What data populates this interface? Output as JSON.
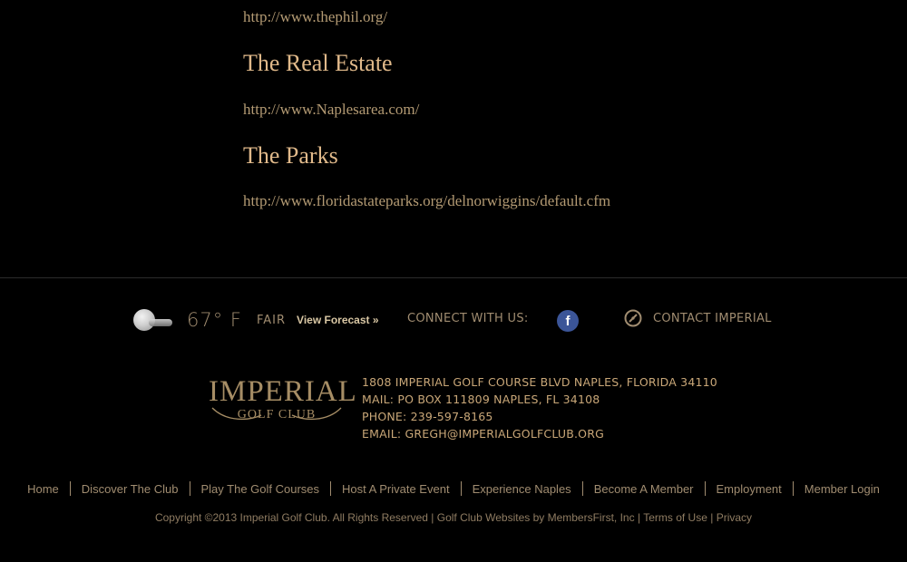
{
  "main": {
    "links": [
      {
        "url": "http://www.thephil.org/"
      },
      {
        "heading": "The Real Estate",
        "url": "http://www.Naplesarea.com/"
      },
      {
        "heading": "The Parks",
        "url": "http://www.floridastateparks.org/delnorwiggins/default.cfm"
      }
    ]
  },
  "weather": {
    "icon": "moon-cloud-icon",
    "temperature": "67° F",
    "condition": "FAIR",
    "forecast_label": "View Forecast »"
  },
  "social": {
    "label": "CONNECT WITH US:",
    "facebook_icon": "facebook-icon",
    "facebook_glyph": "f",
    "facebook_color": "#3b5598"
  },
  "contact": {
    "icon": "compass-icon",
    "label": "CONTACT IMPERIAL"
  },
  "logo": {
    "name": "IMPERIAL",
    "sub": "GOLF CLUB"
  },
  "address": {
    "street": "1808 IMPERIAL GOLF COURSE BLVD NAPLES, FLORIDA 34110",
    "mail": "MAIL: PO BOX 111809 NAPLES, FL 34108",
    "phone": "PHONE: 239-597-8165",
    "email": "EMAIL: GREGH@IMPERIALGOLFCLUB.ORG"
  },
  "footer_nav": [
    "Home",
    "Discover The Club",
    "Play The Golf Courses",
    "Host A Private Event",
    "Experience Naples",
    "Become A Member",
    "Employment",
    "Member Login"
  ],
  "copyright": {
    "text": "Copyright ©2013 Imperial Golf Club. All Rights Reserved |",
    "websites": "Golf Club Websites by MembersFirst, Inc",
    "terms": "Terms of Use",
    "privacy": "Privacy",
    "sep": "|"
  },
  "colors": {
    "background": "#000000",
    "heading": "#e0b98a",
    "link": "#b39a73",
    "footer_text": "#a08c70",
    "address": "#c9a778"
  }
}
